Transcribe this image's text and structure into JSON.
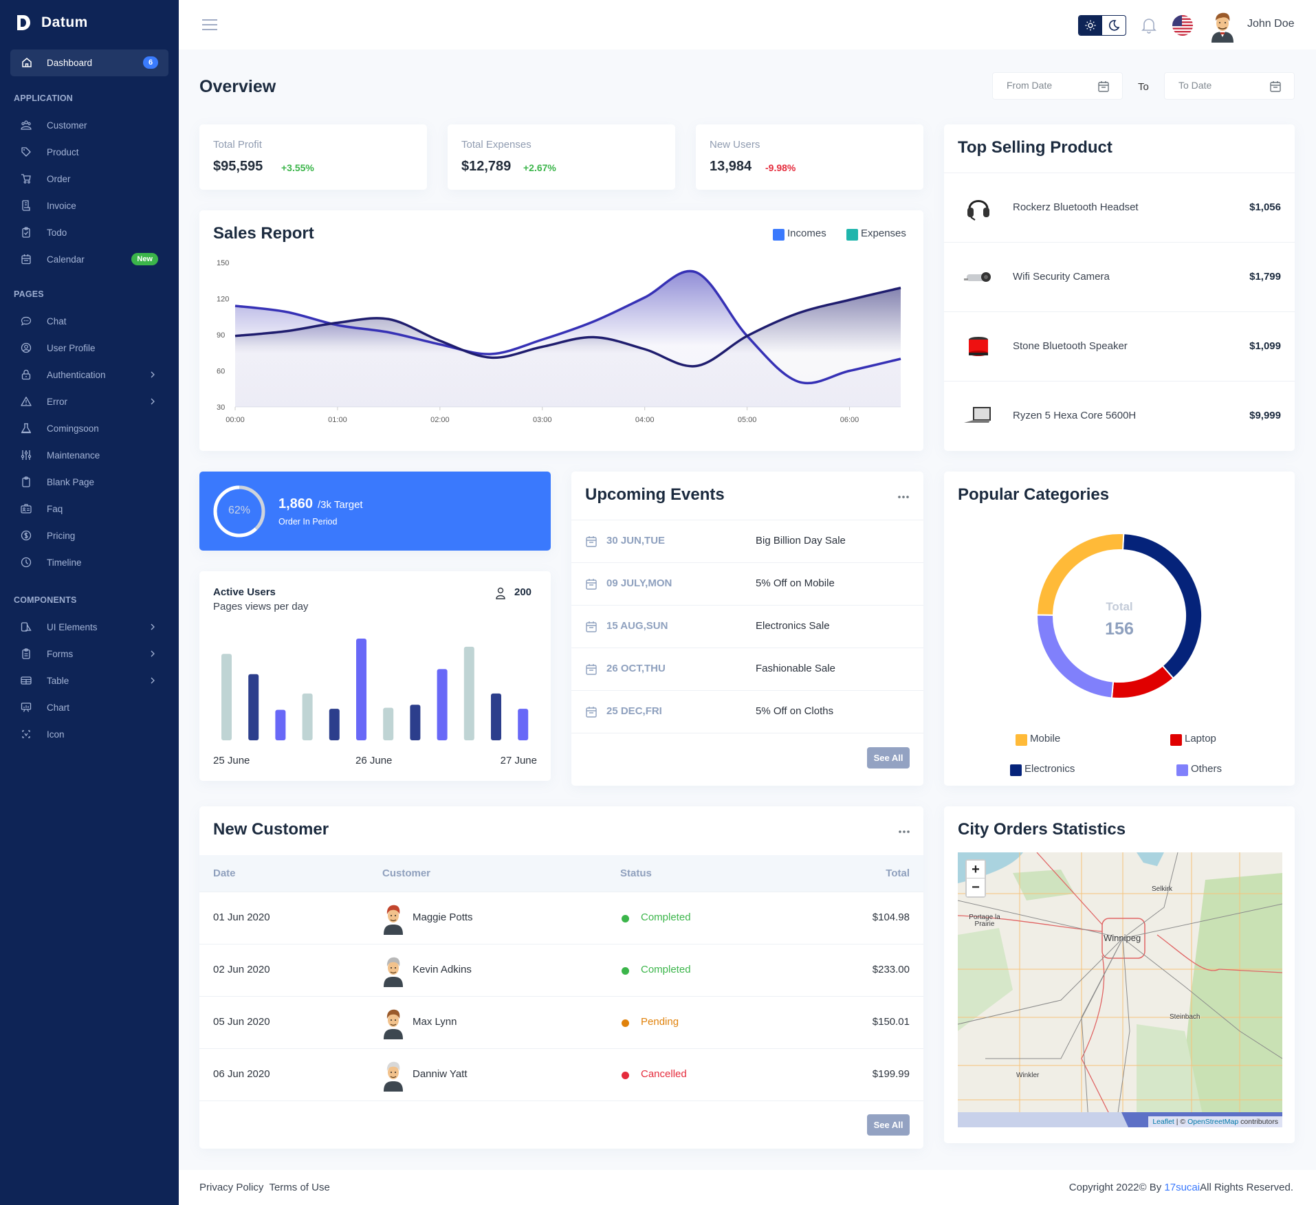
{
  "brand": {
    "name": "Datum"
  },
  "sidebar": {
    "dashboard": {
      "label": "Dashboard",
      "badge": "6"
    },
    "sections": [
      {
        "title": "APPLICATION",
        "items": [
          {
            "label": "Customer",
            "icon": "users-icon"
          },
          {
            "label": "Product",
            "icon": "tag-icon"
          },
          {
            "label": "Order",
            "icon": "cart-icon"
          },
          {
            "label": "Invoice",
            "icon": "receipt-icon"
          },
          {
            "label": "Todo",
            "icon": "clipboard-check-icon"
          },
          {
            "label": "Calendar",
            "icon": "calendar-icon",
            "badge": "New"
          }
        ]
      },
      {
        "title": "PAGES",
        "items": [
          {
            "label": "Chat",
            "icon": "chat-icon"
          },
          {
            "label": "User Profile",
            "icon": "user-circle-icon"
          },
          {
            "label": "Authentication",
            "icon": "lock-icon",
            "has_submenu": true
          },
          {
            "label": "Error",
            "icon": "warning-icon",
            "has_submenu": true
          },
          {
            "label": "Comingsoon",
            "icon": "flask-icon"
          },
          {
            "label": "Maintenance",
            "icon": "sliders-icon"
          },
          {
            "label": "Blank Page",
            "icon": "clipboard-icon"
          },
          {
            "label": "Faq",
            "icon": "id-card-icon"
          },
          {
            "label": "Pricing",
            "icon": "dollar-circle-icon"
          },
          {
            "label": "Timeline",
            "icon": "clock-icon"
          }
        ]
      },
      {
        "title": "COMPONENTS",
        "items": [
          {
            "label": "UI Elements",
            "icon": "ui-elements-icon",
            "has_submenu": true
          },
          {
            "label": "Forms",
            "icon": "form-icon",
            "has_submenu": true
          },
          {
            "label": "Table",
            "icon": "table-icon",
            "has_submenu": true
          },
          {
            "label": "Chart",
            "icon": "presentation-chart-icon"
          },
          {
            "label": "Icon",
            "icon": "icon-set-icon"
          }
        ]
      }
    ]
  },
  "header": {
    "user_name": "John Doe",
    "language": "en-US"
  },
  "overview": {
    "title": "Overview",
    "from_placeholder": "From Date",
    "to_label": "To",
    "to_placeholder": "To Date"
  },
  "stats": [
    {
      "label": "Total Profit",
      "value": "$95,595",
      "change": "+3.55%",
      "trend": "up"
    },
    {
      "label": "Total Expenses",
      "value": "$12,789",
      "change": "+2.67%",
      "trend": "up"
    },
    {
      "label": "New Users",
      "value": "13,984",
      "change": "-9.98%",
      "trend": "down"
    }
  ],
  "colors": {
    "up": "#3bb54a",
    "down": "#e52b3c",
    "accent": "#3a79fd",
    "sidebar": "#0e2456"
  },
  "sales_report": {
    "title": "Sales Report",
    "chart_data": {
      "type": "area",
      "title": "Sales Report",
      "x": [
        "00:00",
        "00:30",
        "01:00",
        "01:30",
        "02:00",
        "02:30",
        "03:00",
        "03:30",
        "04:00",
        "04:30",
        "05:00",
        "05:30",
        "06:00",
        "06:30"
      ],
      "x_tick_labels": [
        "00:00",
        "01:00",
        "02:00",
        "03:00",
        "04:00",
        "05:00",
        "06:00"
      ],
      "y_tick_labels": [
        "150",
        "120",
        "90",
        "60",
        "30"
      ],
      "ylim": [
        30,
        150
      ],
      "legend_position": "top-right",
      "legend": [
        {
          "name": "Incomes",
          "color": "#3a79fd"
        },
        {
          "name": "Expenses",
          "color": "#1fb5ac"
        }
      ],
      "series": [
        {
          "name": "Incomes",
          "line_color": "#3631b5",
          "values": [
            114,
            109,
            98,
            92,
            82,
            74,
            86,
            101,
            121,
            142,
            89,
            51,
            60,
            70
          ]
        },
        {
          "name": "Expenses",
          "line_color": "#1f1d6e",
          "values": [
            89,
            93,
            100,
            103,
            85,
            71,
            80,
            88,
            78,
            64,
            89,
            108,
            119,
            129
          ]
        }
      ]
    }
  },
  "top_selling": {
    "title": "Top Selling Product",
    "products": [
      {
        "name": "Rockerz Bluetooth Headset",
        "price": "$1,056",
        "image": "headset-image"
      },
      {
        "name": "Wifi Security Camera",
        "price": "$1,799",
        "image": "camera-image"
      },
      {
        "name": "Stone Bluetooth Speaker",
        "price": "$1,099",
        "image": "speaker-image"
      },
      {
        "name": "Ryzen 5 Hexa Core 5600H",
        "price": "$9,999",
        "image": "laptop-image"
      }
    ]
  },
  "order_target": {
    "percent": 62,
    "percent_label": "62%",
    "count": "1,860",
    "target": "/3k Target",
    "subtitle": "Order In Period"
  },
  "active_users": {
    "title": "Active Users",
    "subtitle": "Pages views per day",
    "count": "200",
    "chart_data": {
      "type": "bar",
      "categories": [
        "25 June",
        "",
        "",
        "",
        "",
        "26 June",
        "",
        "",
        "",
        "",
        "",
        "27 June"
      ],
      "x_tick_labels": [
        "25 June",
        "26 June",
        "27 June"
      ],
      "values": [
        85,
        65,
        30,
        46,
        31,
        100,
        32,
        35,
        70,
        92,
        46,
        31
      ],
      "colors": [
        "#bfd4d4",
        "#2c3e8c",
        "#6868f7",
        "#bfd4d4",
        "#2c3e8c",
        "#6868f7",
        "#bfd4d4",
        "#2c3e8c",
        "#6868f7",
        "#bfd4d4",
        "#2c3e8c",
        "#6868f7"
      ]
    }
  },
  "events": {
    "title": "Upcoming Events",
    "items": [
      {
        "date": "30 JUN,TUE",
        "name": "Big Billion Day Sale"
      },
      {
        "date": "09 JULY,MON",
        "name": "5% Off on Mobile"
      },
      {
        "date": "15 AUG,SUN",
        "name": "Electronics Sale"
      },
      {
        "date": "26 OCT,THU",
        "name": "Fashionable Sale"
      },
      {
        "date": "25 DEC,FRI",
        "name": "5% Off on Cloths"
      }
    ],
    "see_all": "See All"
  },
  "categories": {
    "title": "Popular Categories",
    "center_label": "Total",
    "center_value": "156",
    "chart_data": {
      "type": "pie",
      "total": 156,
      "slices": [
        {
          "name": "Electronics",
          "value": 59,
          "color": "#05237a"
        },
        {
          "name": "Laptop",
          "value": 20,
          "color": "#e00000"
        },
        {
          "name": "Others",
          "value": 37,
          "color": "#8080fb"
        },
        {
          "name": "Mobile",
          "value": 40,
          "color": "#ffba38"
        }
      ],
      "legend": [
        "Mobile",
        "Laptop",
        "Electronics",
        "Others"
      ],
      "legend_position": "bottom"
    }
  },
  "customers": {
    "title": "New Customer",
    "columns": [
      "Date",
      "Customer",
      "Status",
      "Total"
    ],
    "rows": [
      {
        "date": "01 Jun 2020",
        "name": "Maggie Potts",
        "status": "Completed",
        "total": "$104.98",
        "status_color": "#3bb54a",
        "avatar": "avatar-woman-red-hair"
      },
      {
        "date": "02 Jun 2020",
        "name": "Kevin Adkins",
        "status": "Completed",
        "total": "$233.00",
        "status_color": "#3bb54a",
        "avatar": "avatar-man-gray-hair"
      },
      {
        "date": "05 Jun 2020",
        "name": "Max Lynn",
        "status": "Pending",
        "total": "$150.01",
        "status_color": "#e0820b",
        "avatar": "avatar-man-brown-hair"
      },
      {
        "date": "06 Jun 2020",
        "name": "Danniw Yatt",
        "status": "Cancelled",
        "total": "$199.99",
        "status_color": "#e52b3c",
        "avatar": "avatar-old-man"
      }
    ],
    "see_all": "See All"
  },
  "city_orders": {
    "title": "City Orders Statistics",
    "map_labels": [
      "Selkirk",
      "Portage la Prairie",
      "Winnipeg",
      "Steinbach",
      "Winkler"
    ],
    "zoom_in": "+",
    "zoom_out": "−",
    "attribution_leaflet": "Leaflet",
    "attribution_sep": " | © ",
    "attribution_osm": "OpenStreetMap",
    "attribution_rest": " contributors"
  },
  "footer": {
    "privacy": "Privacy Policy",
    "terms": "Terms of Use",
    "copyright_pre": "Copyright 2022© By ",
    "copyright_link": "17sucai",
    "copyright_post": "All Rights Reserved."
  }
}
